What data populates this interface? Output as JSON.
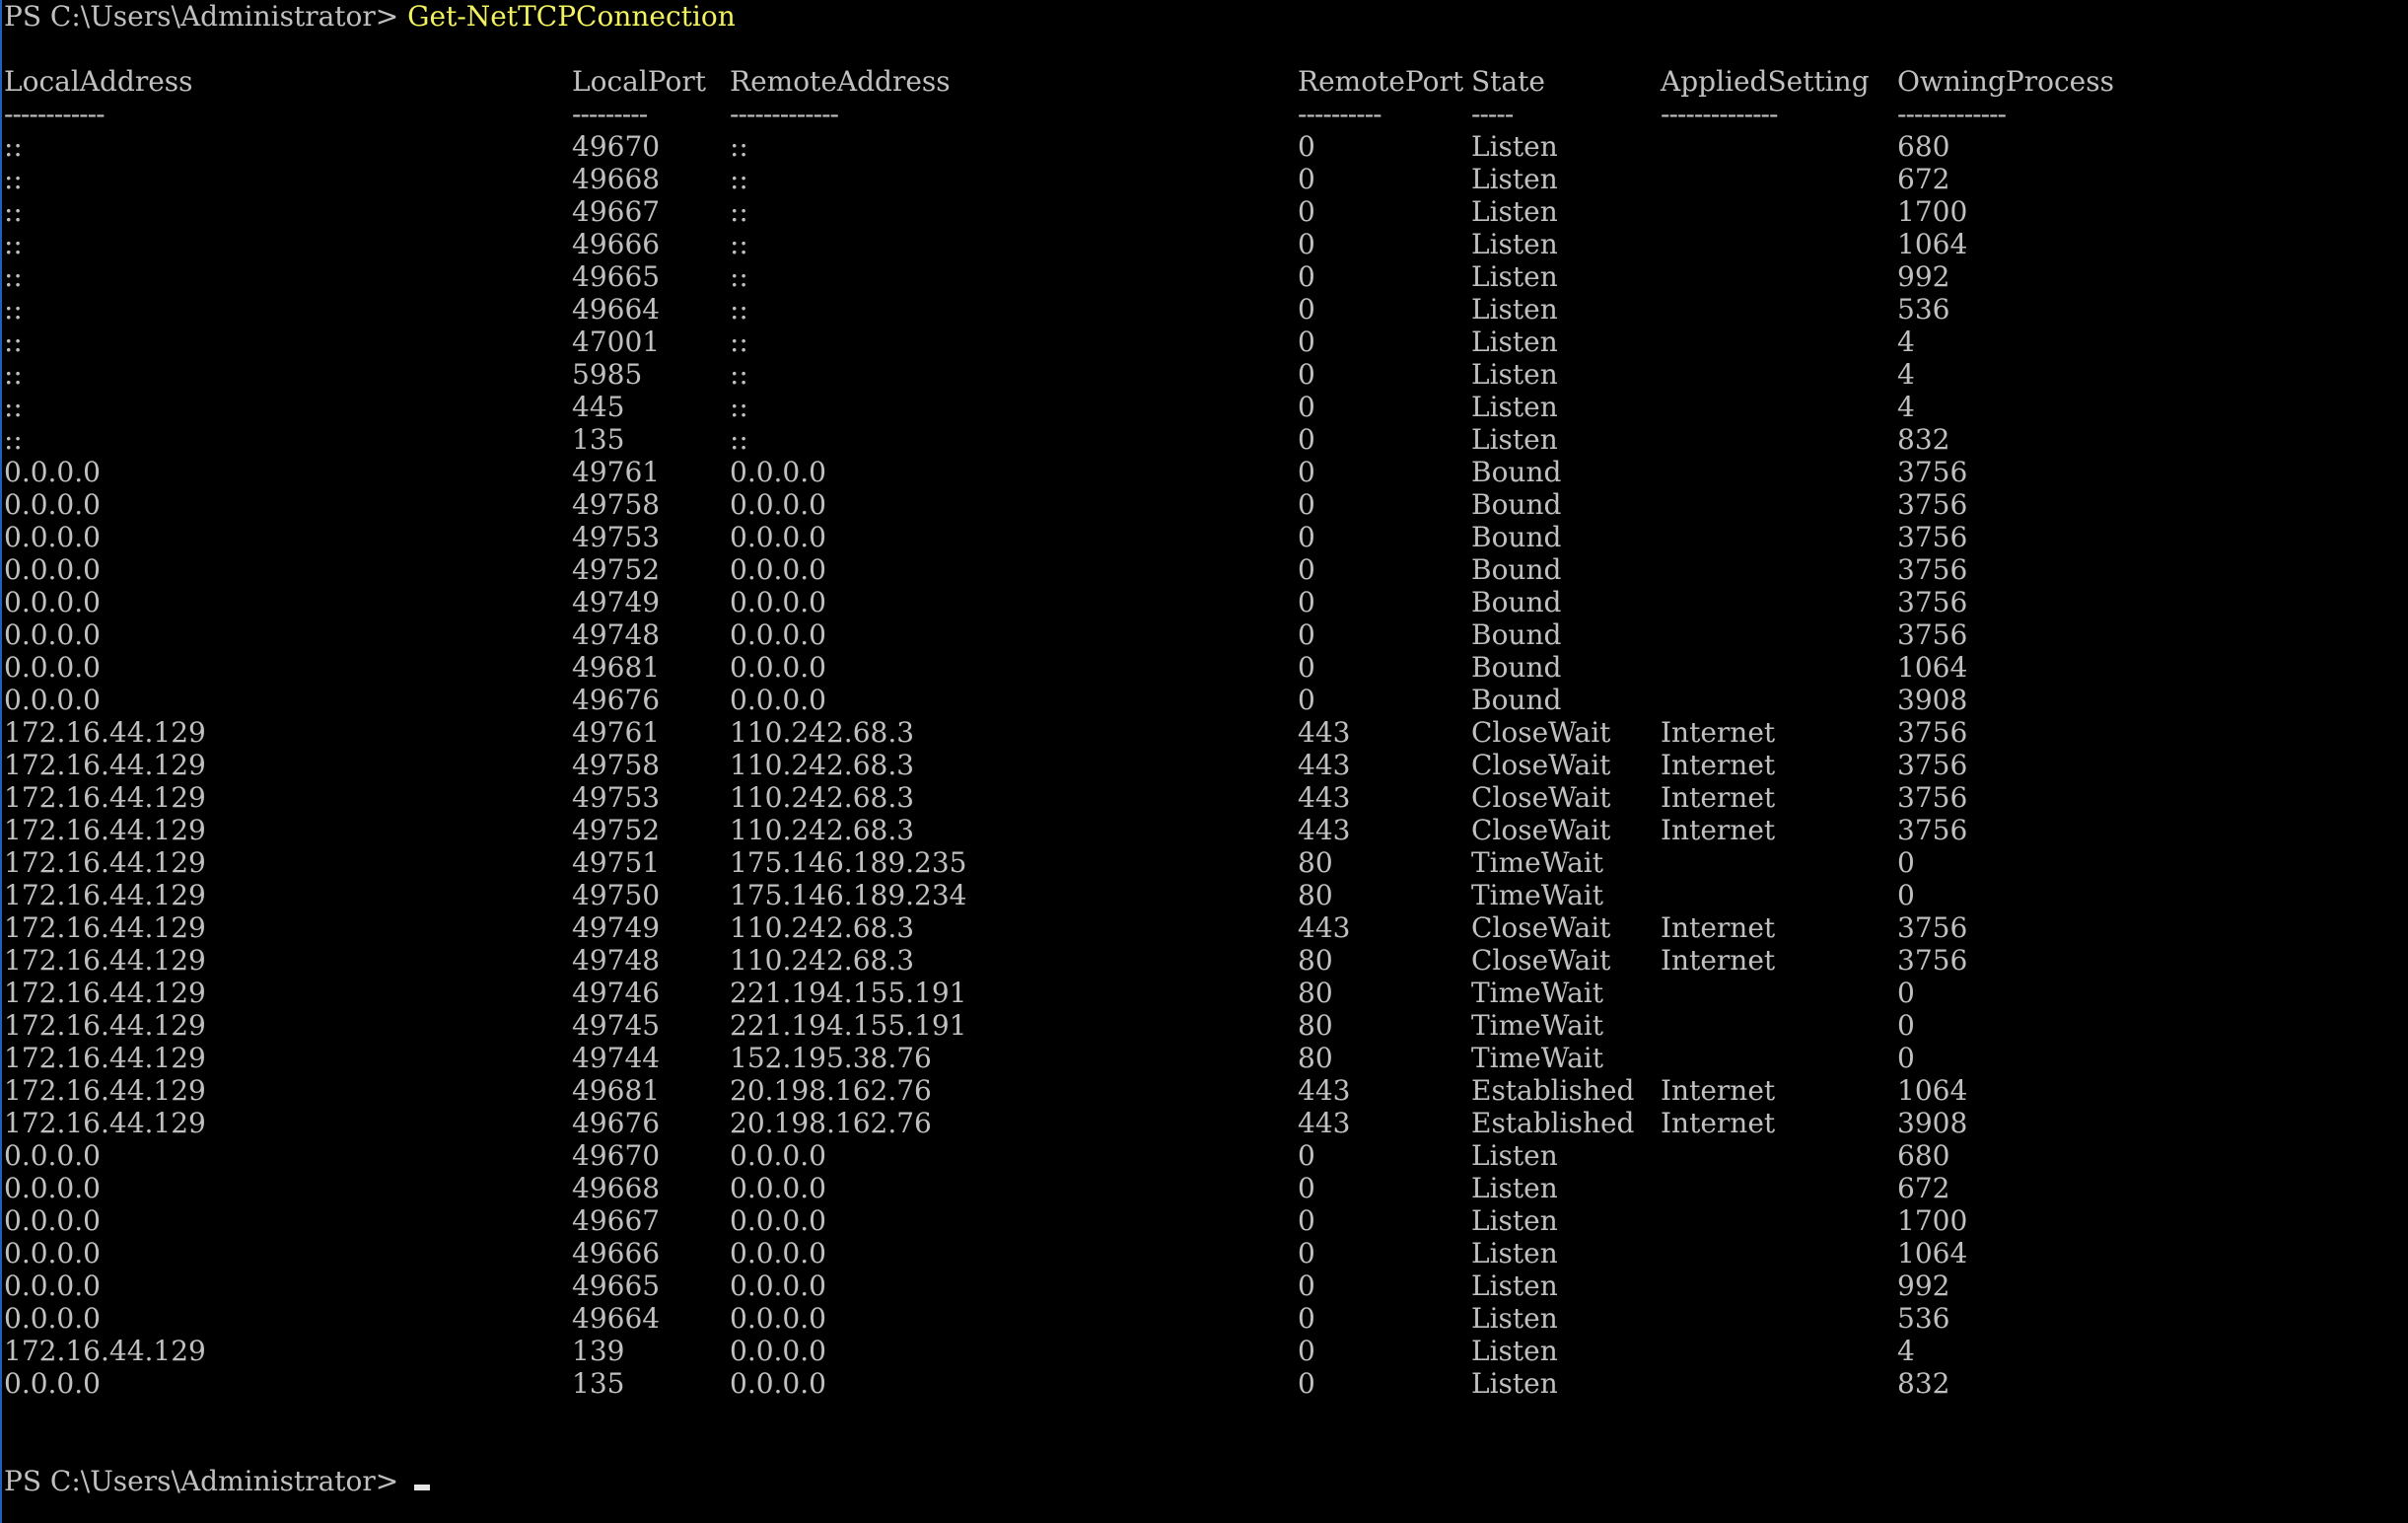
{
  "window": {
    "prompt": "PS C:\\Users\\Administrator>",
    "command": "Get-NetTCPConnection",
    "text_color": "#c0c0c0",
    "command_color": "#f2f261",
    "background": "#000000"
  },
  "table": {
    "headers": [
      "LocalAddress",
      "LocalPort",
      "RemoteAddress",
      "RemotePort",
      "State",
      "AppliedSetting",
      "OwningProcess"
    ],
    "separators": [
      "------------",
      "---------",
      "-------------",
      "----------",
      "-----",
      "--------------",
      "-------------"
    ],
    "rows": [
      [
        "::",
        "49670",
        "::",
        "0",
        "Listen",
        "",
        "680"
      ],
      [
        "::",
        "49668",
        "::",
        "0",
        "Listen",
        "",
        "672"
      ],
      [
        "::",
        "49667",
        "::",
        "0",
        "Listen",
        "",
        "1700"
      ],
      [
        "::",
        "49666",
        "::",
        "0",
        "Listen",
        "",
        "1064"
      ],
      [
        "::",
        "49665",
        "::",
        "0",
        "Listen",
        "",
        "992"
      ],
      [
        "::",
        "49664",
        "::",
        "0",
        "Listen",
        "",
        "536"
      ],
      [
        "::",
        "47001",
        "::",
        "0",
        "Listen",
        "",
        "4"
      ],
      [
        "::",
        "5985",
        "::",
        "0",
        "Listen",
        "",
        "4"
      ],
      [
        "::",
        "445",
        "::",
        "0",
        "Listen",
        "",
        "4"
      ],
      [
        "::",
        "135",
        "::",
        "0",
        "Listen",
        "",
        "832"
      ],
      [
        "0.0.0.0",
        "49761",
        "0.0.0.0",
        "0",
        "Bound",
        "",
        "3756"
      ],
      [
        "0.0.0.0",
        "49758",
        "0.0.0.0",
        "0",
        "Bound",
        "",
        "3756"
      ],
      [
        "0.0.0.0",
        "49753",
        "0.0.0.0",
        "0",
        "Bound",
        "",
        "3756"
      ],
      [
        "0.0.0.0",
        "49752",
        "0.0.0.0",
        "0",
        "Bound",
        "",
        "3756"
      ],
      [
        "0.0.0.0",
        "49749",
        "0.0.0.0",
        "0",
        "Bound",
        "",
        "3756"
      ],
      [
        "0.0.0.0",
        "49748",
        "0.0.0.0",
        "0",
        "Bound",
        "",
        "3756"
      ],
      [
        "0.0.0.0",
        "49681",
        "0.0.0.0",
        "0",
        "Bound",
        "",
        "1064"
      ],
      [
        "0.0.0.0",
        "49676",
        "0.0.0.0",
        "0",
        "Bound",
        "",
        "3908"
      ],
      [
        "172.16.44.129",
        "49761",
        "110.242.68.3",
        "443",
        "CloseWait",
        "Internet",
        "3756"
      ],
      [
        "172.16.44.129",
        "49758",
        "110.242.68.3",
        "443",
        "CloseWait",
        "Internet",
        "3756"
      ],
      [
        "172.16.44.129",
        "49753",
        "110.242.68.3",
        "443",
        "CloseWait",
        "Internet",
        "3756"
      ],
      [
        "172.16.44.129",
        "49752",
        "110.242.68.3",
        "443",
        "CloseWait",
        "Internet",
        "3756"
      ],
      [
        "172.16.44.129",
        "49751",
        "175.146.189.235",
        "80",
        "TimeWait",
        "",
        "0"
      ],
      [
        "172.16.44.129",
        "49750",
        "175.146.189.234",
        "80",
        "TimeWait",
        "",
        "0"
      ],
      [
        "172.16.44.129",
        "49749",
        "110.242.68.3",
        "443",
        "CloseWait",
        "Internet",
        "3756"
      ],
      [
        "172.16.44.129",
        "49748",
        "110.242.68.3",
        "80",
        "CloseWait",
        "Internet",
        "3756"
      ],
      [
        "172.16.44.129",
        "49746",
        "221.194.155.191",
        "80",
        "TimeWait",
        "",
        "0"
      ],
      [
        "172.16.44.129",
        "49745",
        "221.194.155.191",
        "80",
        "TimeWait",
        "",
        "0"
      ],
      [
        "172.16.44.129",
        "49744",
        "152.195.38.76",
        "80",
        "TimeWait",
        "",
        "0"
      ],
      [
        "172.16.44.129",
        "49681",
        "20.198.162.76",
        "443",
        "Established",
        "Internet",
        "1064"
      ],
      [
        "172.16.44.129",
        "49676",
        "20.198.162.76",
        "443",
        "Established",
        "Internet",
        "3908"
      ],
      [
        "0.0.0.0",
        "49670",
        "0.0.0.0",
        "0",
        "Listen",
        "",
        "680"
      ],
      [
        "0.0.0.0",
        "49668",
        "0.0.0.0",
        "0",
        "Listen",
        "",
        "672"
      ],
      [
        "0.0.0.0",
        "49667",
        "0.0.0.0",
        "0",
        "Listen",
        "",
        "1700"
      ],
      [
        "0.0.0.0",
        "49666",
        "0.0.0.0",
        "0",
        "Listen",
        "",
        "1064"
      ],
      [
        "0.0.0.0",
        "49665",
        "0.0.0.0",
        "0",
        "Listen",
        "",
        "992"
      ],
      [
        "0.0.0.0",
        "49664",
        "0.0.0.0",
        "0",
        "Listen",
        "",
        "536"
      ],
      [
        "172.16.44.129",
        "139",
        "0.0.0.0",
        "0",
        "Listen",
        "",
        "4"
      ],
      [
        "0.0.0.0",
        "135",
        "0.0.0.0",
        "0",
        "Listen",
        "",
        "832"
      ]
    ]
  }
}
